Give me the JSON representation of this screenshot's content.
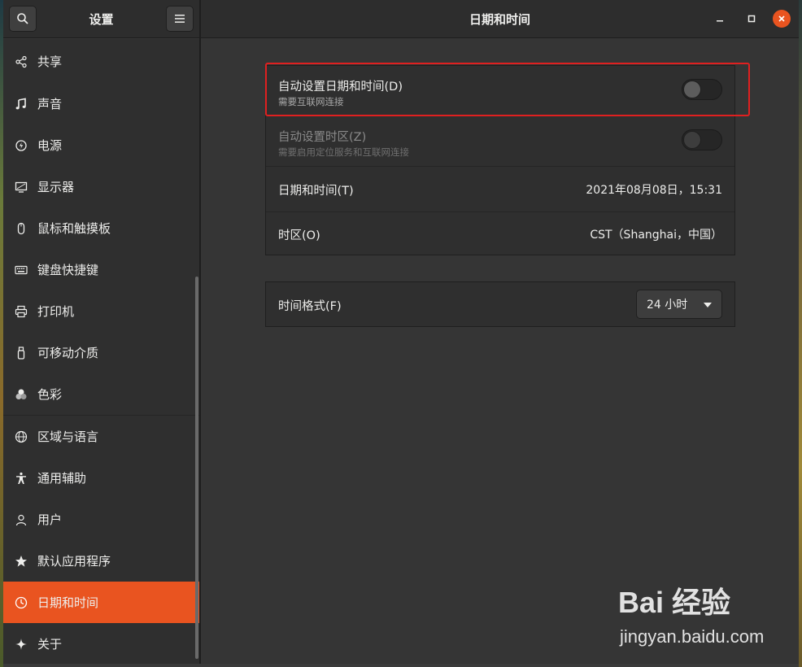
{
  "sidebar_header": {
    "title": "设置",
    "search_icon": "search-icon",
    "menu_icon": "hamburger-menu-icon"
  },
  "main_header": {
    "title": "日期和时间"
  },
  "window_controls": {
    "minimize": "–",
    "maximize": "□",
    "close": "×"
  },
  "sidebar": {
    "items": [
      {
        "label": "共享",
        "icon": "share-icon"
      },
      {
        "label": "声音",
        "icon": "music-note-icon"
      },
      {
        "label": "电源",
        "icon": "power-icon"
      },
      {
        "label": "显示器",
        "icon": "display-icon"
      },
      {
        "label": "鼠标和触摸板",
        "icon": "mouse-icon"
      },
      {
        "label": "键盘快捷键",
        "icon": "keyboard-icon"
      },
      {
        "label": "打印机",
        "icon": "printer-icon"
      },
      {
        "label": "可移动介质",
        "icon": "removable-media-icon"
      },
      {
        "label": "色彩",
        "icon": "color-icon"
      },
      {
        "label": "区域与语言",
        "icon": "globe-icon"
      },
      {
        "label": "通用辅助",
        "icon": "accessibility-icon"
      },
      {
        "label": "用户",
        "icon": "users-icon"
      },
      {
        "label": "默认应用程序",
        "icon": "star-icon"
      },
      {
        "label": "日期和时间",
        "icon": "clock-icon"
      },
      {
        "label": "关于",
        "icon": "sparkle-icon"
      }
    ],
    "active_index": 13
  },
  "datetime": {
    "auto_datetime_title": "自动设置日期和时间(D)",
    "auto_datetime_sub": "需要互联网连接",
    "auto_timezone_title": "自动设置时区(Z)",
    "auto_timezone_sub": "需要启用定位服务和互联网连接",
    "datetime_label": "日期和时间(T)",
    "datetime_value": "2021年08月08日，15:31",
    "timezone_label": "时区(O)",
    "timezone_value": "CST（Shanghai，中国）",
    "time_format_label": "时间格式(F)",
    "time_format_value": "24 小时"
  },
  "colors": {
    "accent": "#e95420",
    "highlight_box": "#e02020"
  },
  "watermark": {
    "brand": "Bai 经验",
    "url": "jingyan.baidu.com"
  }
}
